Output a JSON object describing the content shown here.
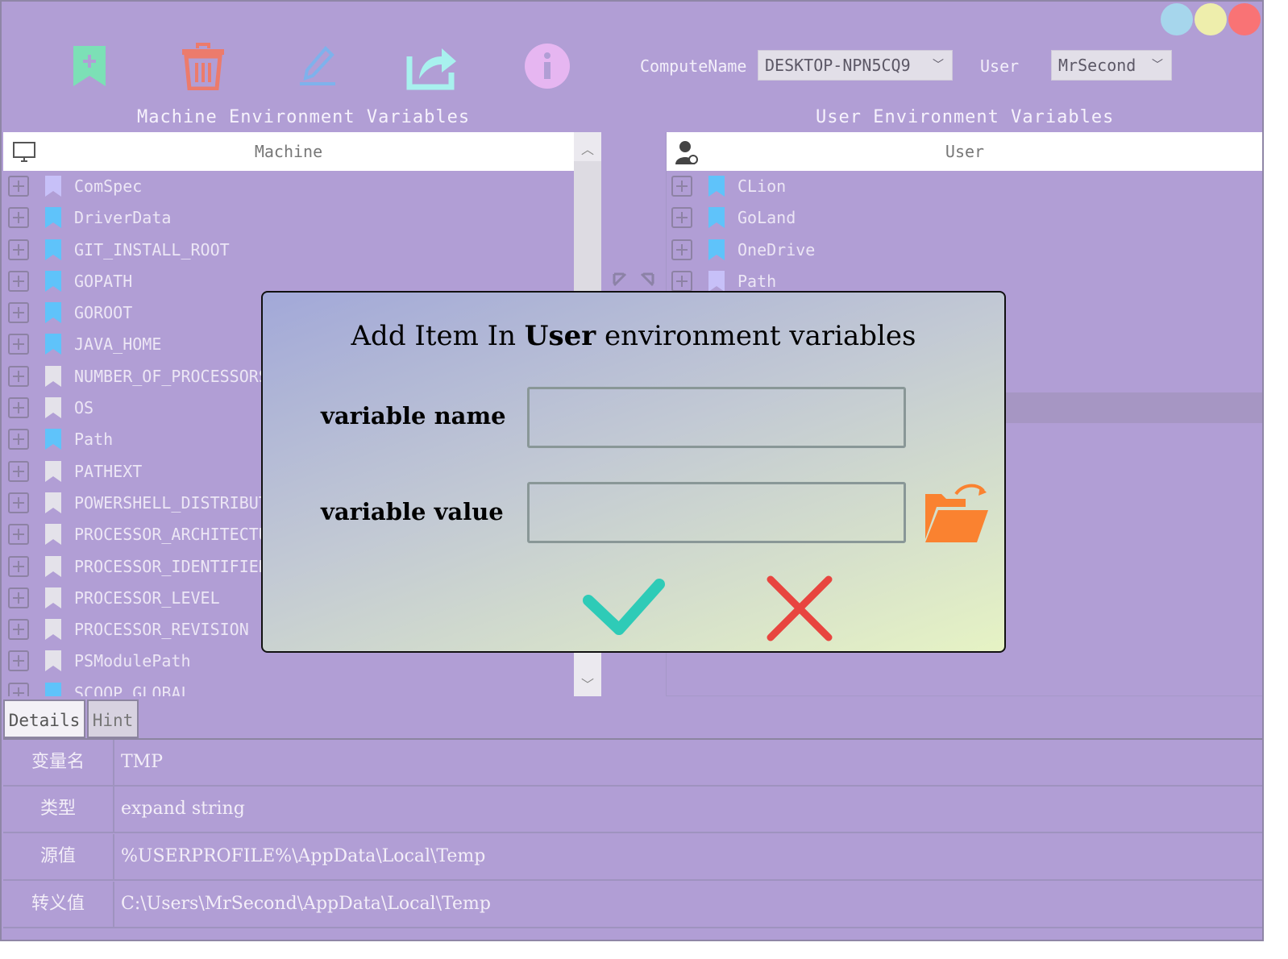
{
  "window": {
    "controls": [
      {
        "name": "minimize-control",
        "color": "#a6d6ec"
      },
      {
        "name": "maximize-control",
        "color": "#eeeeac"
      },
      {
        "name": "close-control",
        "color": "#f97375"
      }
    ]
  },
  "toolbar": {
    "buttons": [
      {
        "icon": "bookmark-add-icon",
        "color": "#7ce0b6"
      },
      {
        "icon": "trash-icon",
        "color": "#ec7b6c"
      },
      {
        "icon": "pencil-icon",
        "color": "#7eb2ec"
      },
      {
        "icon": "share-icon",
        "color": "#a8f1ee"
      },
      {
        "icon": "info-icon",
        "color": "#e6b6f1"
      }
    ],
    "compute_name_label": "ComputeName",
    "compute_name_value": "DESKTOP-NPN5CQ9",
    "user_label": "User",
    "user_value": "MrSecond"
  },
  "machine": {
    "section_title": "Machine Environment Variables",
    "header": "Machine",
    "items": [
      {
        "name": "ComSpec",
        "bookmark": "#c7c0f8"
      },
      {
        "name": "DriverData",
        "bookmark": "#5fc3fa"
      },
      {
        "name": "GIT_INSTALL_ROOT",
        "bookmark": "#5fc3fa"
      },
      {
        "name": "GOPATH",
        "bookmark": "#5fc3fa"
      },
      {
        "name": "GOROOT",
        "bookmark": "#5fc3fa"
      },
      {
        "name": "JAVA_HOME",
        "bookmark": "#5fc3fa"
      },
      {
        "name": "NUMBER_OF_PROCESSORS",
        "bookmark": "#e4e2ea"
      },
      {
        "name": "OS",
        "bookmark": "#e4e2ea"
      },
      {
        "name": "Path",
        "bookmark": "#5fc3fa"
      },
      {
        "name": "PATHEXT",
        "bookmark": "#e4e2ea"
      },
      {
        "name": "POWERSHELL_DISTRIBUTION_CHANNEL",
        "bookmark": "#e4e2ea"
      },
      {
        "name": "PROCESSOR_ARCHITECTURE",
        "bookmark": "#e4e2ea"
      },
      {
        "name": "PROCESSOR_IDENTIFIER",
        "bookmark": "#e4e2ea"
      },
      {
        "name": "PROCESSOR_LEVEL",
        "bookmark": "#e4e2ea"
      },
      {
        "name": "PROCESSOR_REVISION",
        "bookmark": "#e4e2ea"
      },
      {
        "name": "PSModulePath",
        "bookmark": "#e4e2ea"
      },
      {
        "name": "SCOOP_GLOBAL",
        "bookmark": "#5fc3fa"
      }
    ]
  },
  "user": {
    "section_title": "User Environment Variables",
    "header": "User",
    "items": [
      {
        "name": "CLion",
        "bookmark": "#5fc3fa"
      },
      {
        "name": "GoLand",
        "bookmark": "#5fc3fa"
      },
      {
        "name": "OneDrive",
        "bookmark": "#5fc3fa"
      },
      {
        "name": "Path",
        "bookmark": "#c7c0f8"
      }
    ]
  },
  "tabs": {
    "details": "Details",
    "hint": "Hint"
  },
  "details": [
    {
      "key": "变量名",
      "value": "TMP"
    },
    {
      "key": "类型",
      "value": "expand string"
    },
    {
      "key": "源值",
      "value": "%USERPROFILE%\\AppData\\Local\\Temp"
    },
    {
      "key": "转义值",
      "value": "C:\\Users\\MrSecond\\AppData\\Local\\Temp"
    }
  ],
  "dialog": {
    "title_prefix": "Add Item In",
    "title_strong": "User",
    "title_suffix": "environment variables",
    "name_label": "variable name",
    "name_value": "",
    "value_label": "variable value",
    "value_value": "",
    "folder_icon_color": "#fa8230",
    "confirm_color": "#2ecbb7",
    "cancel_color": "#e8453f"
  }
}
